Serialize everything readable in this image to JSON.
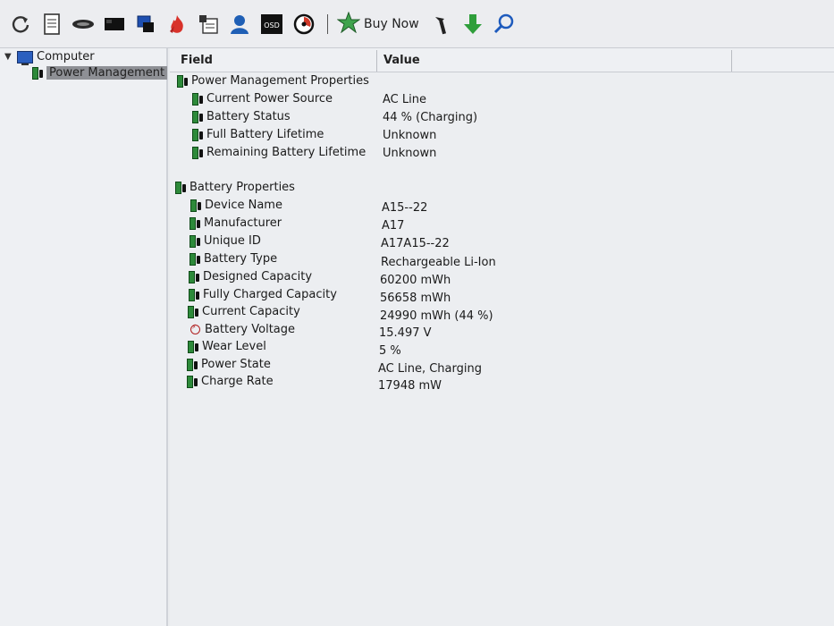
{
  "toolbar": {
    "icons": [
      "refresh-icon",
      "report-icon",
      "chip-icon",
      "motherboard-icon",
      "display-icon",
      "flame-icon",
      "audit-icon",
      "user-icon",
      "osd-icon",
      "sensor-icon"
    ],
    "osd_label": "OSD",
    "buy_now_label": "Buy Now",
    "tools_icon": "tools-icon",
    "download_icon": "download-arrow-icon",
    "search_icon": "search-icon"
  },
  "tree": {
    "root_label": "Computer",
    "child_label": "Power Management"
  },
  "grid": {
    "columns": {
      "field": "Field",
      "value": "Value"
    },
    "sections": [
      {
        "title": "Power Management Properties",
        "rows": [
          {
            "field": "Current Power Source",
            "value": "AC Line"
          },
          {
            "field": "Battery Status",
            "value": "44 % (Charging)"
          },
          {
            "field": "Full Battery Lifetime",
            "value": "Unknown"
          },
          {
            "field": "Remaining Battery Lifetime",
            "value": "Unknown"
          }
        ]
      },
      {
        "title": "Battery Properties",
        "rows": [
          {
            "field": "Device Name",
            "value": "A15--22"
          },
          {
            "field": "Manufacturer",
            "value": "A17"
          },
          {
            "field": "Unique ID",
            "value": "A17A15--22"
          },
          {
            "field": "Battery Type",
            "value": "Rechargeable Li-Ion"
          },
          {
            "field": "Designed Capacity",
            "value": "60200 mWh"
          },
          {
            "field": "Fully Charged Capacity",
            "value": "56658 mWh"
          },
          {
            "field": "Current Capacity",
            "value": "24990 mWh  (44 %)"
          },
          {
            "field": "Battery Voltage",
            "value": "15.497 V"
          },
          {
            "field": "Wear Level",
            "value": "5 %"
          },
          {
            "field": "Power State",
            "value": "AC Line, Charging"
          },
          {
            "field": "Charge Rate",
            "value": "17948 mW"
          }
        ]
      }
    ]
  }
}
